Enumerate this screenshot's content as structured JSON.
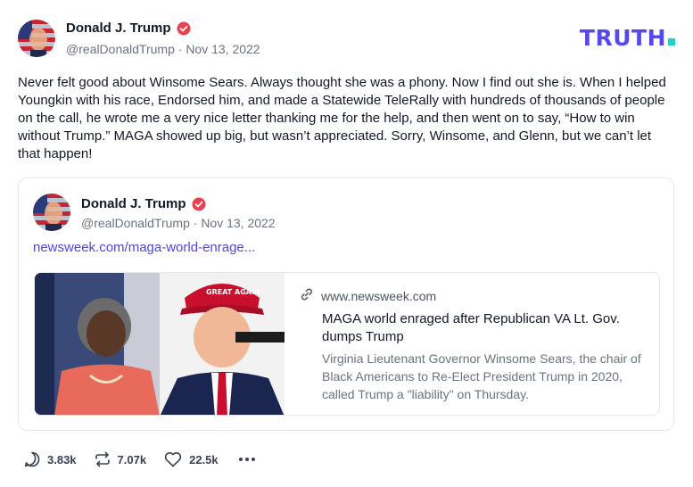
{
  "post": {
    "author_name": "Donald J. Trump",
    "handle": "@realDonaldTrump",
    "separator": "·",
    "date": "Nov 13, 2022",
    "text": "Never felt good about Winsome Sears. Always thought she was a phony. Now I find out she is. When I helped Youngkin with his race, Endorsed him, and made a Statewide TeleRally with hundreds of thousands of people on the call, he wrote me a very nice letter thanking me for the help, and then went on to say, “How to win without Trump.” MAGA showed up big, but wasn’t appreciated. Sorry, Winsome, and Glenn, but we can’t let that happen!"
  },
  "brand": {
    "logo_text": "TRUTH",
    "logo_color": "#5448ee",
    "dot_color": "#19d3c5"
  },
  "quote": {
    "author_name": "Donald J. Trump",
    "handle": "@realDonaldTrump",
    "separator": "·",
    "date": "Nov 13, 2022",
    "link_text": "newsweek.com/maga-world-enrage...",
    "card": {
      "domain": "www.newsweek.com",
      "title": "MAGA world enraged after Republican VA Lt. Gov. dumps Trump",
      "description": "Virginia Lieutenant Governor Winsome Sears, the chair of Black Americans to Re-Elect President Trump in 2020, called Trump a \"liability\" on Thursday.",
      "image_text": "GREAT AGAIN"
    }
  },
  "actions": {
    "replies": "3.83k",
    "retruths": "7.07k",
    "likes": "22.5k"
  },
  "icons": {
    "verified": "verified-badge-icon",
    "reply": "reply-icon",
    "retruth": "retruth-icon",
    "like": "heart-icon",
    "more": "more-icon",
    "link": "link-icon"
  },
  "colors": {
    "verified": "#e8414f",
    "link": "#4f46e5"
  }
}
